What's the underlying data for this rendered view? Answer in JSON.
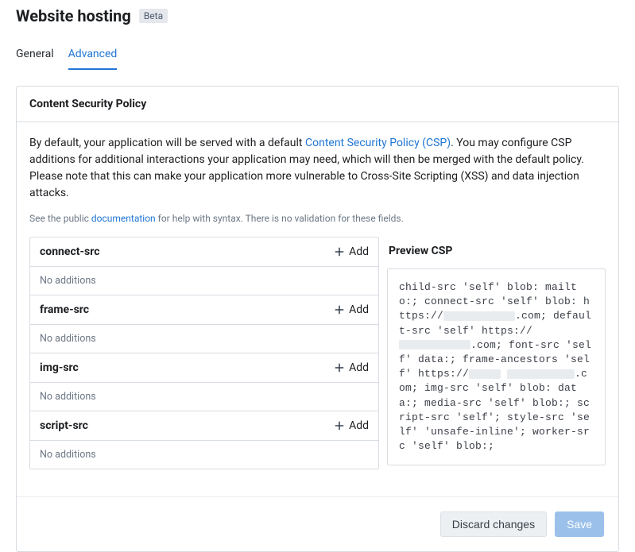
{
  "page": {
    "title": "Website hosting",
    "badge": "Beta"
  },
  "tabs": {
    "general": "General",
    "advanced": "Advanced"
  },
  "csp": {
    "header": "Content Security Policy",
    "desc_pre": "By default, your application will be served with a default ",
    "desc_link": "Content Security Policy (CSP)",
    "desc_post": ". You may configure CSP additions for additional interactions your application may need, which will then be merged with the default policy. Please note that this can make your application more vulnerable to Cross-Site Scripting (XSS) and data injection attacks.",
    "sub_pre": "See the public ",
    "sub_link": "documentation",
    "sub_post": " for help with syntax. There is no validation for these fields.",
    "directives": [
      {
        "name": "connect-src",
        "status": "No additions"
      },
      {
        "name": "frame-src",
        "status": "No additions"
      },
      {
        "name": "img-src",
        "status": "No additions"
      },
      {
        "name": "script-src",
        "status": "No additions"
      }
    ],
    "add_label": "Add",
    "preview_title": "Preview CSP",
    "preview": {
      "p1": "child-src 'self' blob: mailto:; connect-src 'self' blob: https://",
      "p2": ".com; default-src 'self' https://",
      "p3": ".com; font-src 'self' data:; frame-ancestors 'self' https://",
      "p4": ".com; img-src 'self' blob: data:; media-src 'self' blob:; script-src 'self'; style-src 'self' 'unsafe-inline'; worker-src 'self' blob:;"
    }
  },
  "footer": {
    "discard": "Discard changes",
    "save": "Save"
  }
}
